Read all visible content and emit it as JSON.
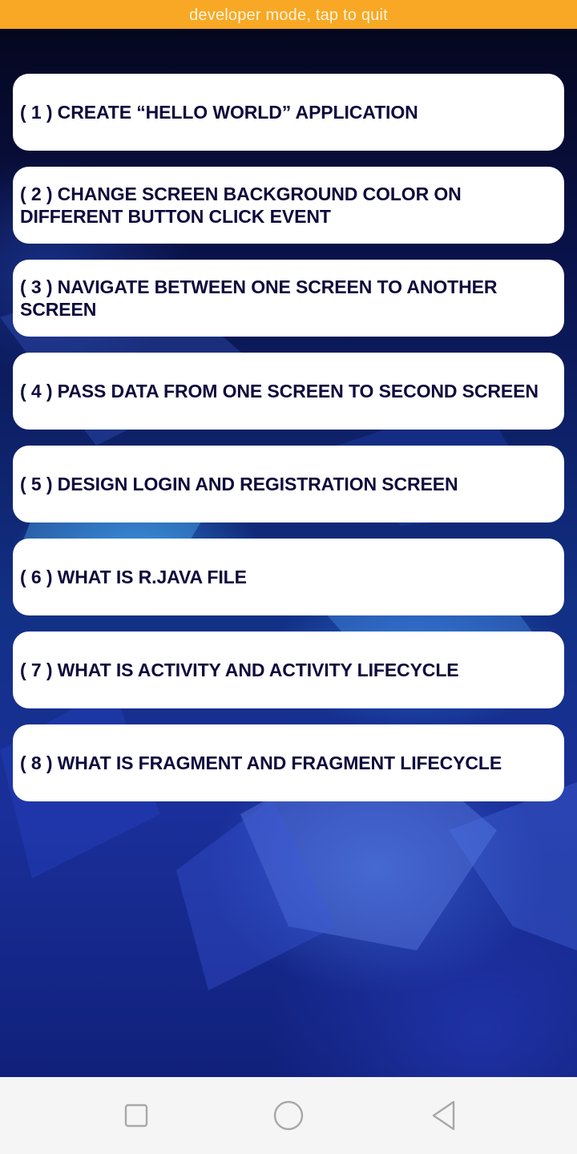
{
  "banner": {
    "text": "developer mode, tap to quit"
  },
  "menu": {
    "items": [
      {
        "label": "( 1 ) CREATE “HELLO WORLD” APPLICATION"
      },
      {
        "label": "( 2 ) CHANGE SCREEN BACKGROUND COLOR ON DIFFERENT BUTTON CLICK EVENT"
      },
      {
        "label": "( 3 ) NAVIGATE BETWEEN ONE SCREEN TO ANOTHER SCREEN"
      },
      {
        "label": "( 4 ) PASS DATA FROM ONE SCREEN TO SECOND SCREEN"
      },
      {
        "label": "( 5 ) DESIGN LOGIN AND REGISTRATION SCREEN"
      },
      {
        "label": "( 6 ) WHAT IS R.JAVA FILE"
      },
      {
        "label": "( 7 ) WHAT IS ACTIVITY AND ACTIVITY LIFECYCLE"
      },
      {
        "label": "( 8 ) WHAT IS FRAGMENT AND FRAGMENT LIFECYCLE"
      }
    ]
  },
  "nav": {
    "recents_icon": "square-icon",
    "home_icon": "circle-icon",
    "back_icon": "triangle-back-icon"
  },
  "colors": {
    "banner_bg": "#f8a824",
    "item_text": "#0e0a3c",
    "item_bg": "#ffffff",
    "nav_bg": "#f5f5f5"
  }
}
